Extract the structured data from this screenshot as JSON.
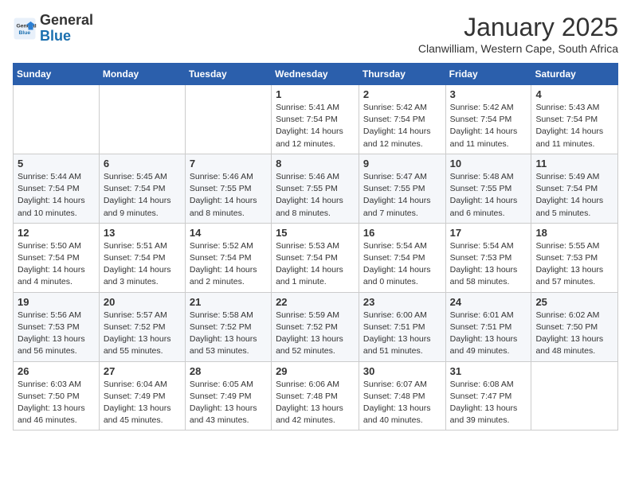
{
  "logo": {
    "line1": "General",
    "line2": "Blue"
  },
  "title": "January 2025",
  "subtitle": "Clanwilliam, Western Cape, South Africa",
  "weekdays": [
    "Sunday",
    "Monday",
    "Tuesday",
    "Wednesday",
    "Thursday",
    "Friday",
    "Saturday"
  ],
  "weeks": [
    [
      {
        "day": "",
        "info": ""
      },
      {
        "day": "",
        "info": ""
      },
      {
        "day": "",
        "info": ""
      },
      {
        "day": "1",
        "info": "Sunrise: 5:41 AM\nSunset: 7:54 PM\nDaylight: 14 hours\nand 12 minutes."
      },
      {
        "day": "2",
        "info": "Sunrise: 5:42 AM\nSunset: 7:54 PM\nDaylight: 14 hours\nand 12 minutes."
      },
      {
        "day": "3",
        "info": "Sunrise: 5:42 AM\nSunset: 7:54 PM\nDaylight: 14 hours\nand 11 minutes."
      },
      {
        "day": "4",
        "info": "Sunrise: 5:43 AM\nSunset: 7:54 PM\nDaylight: 14 hours\nand 11 minutes."
      }
    ],
    [
      {
        "day": "5",
        "info": "Sunrise: 5:44 AM\nSunset: 7:54 PM\nDaylight: 14 hours\nand 10 minutes."
      },
      {
        "day": "6",
        "info": "Sunrise: 5:45 AM\nSunset: 7:54 PM\nDaylight: 14 hours\nand 9 minutes."
      },
      {
        "day": "7",
        "info": "Sunrise: 5:46 AM\nSunset: 7:55 PM\nDaylight: 14 hours\nand 8 minutes."
      },
      {
        "day": "8",
        "info": "Sunrise: 5:46 AM\nSunset: 7:55 PM\nDaylight: 14 hours\nand 8 minutes."
      },
      {
        "day": "9",
        "info": "Sunrise: 5:47 AM\nSunset: 7:55 PM\nDaylight: 14 hours\nand 7 minutes."
      },
      {
        "day": "10",
        "info": "Sunrise: 5:48 AM\nSunset: 7:55 PM\nDaylight: 14 hours\nand 6 minutes."
      },
      {
        "day": "11",
        "info": "Sunrise: 5:49 AM\nSunset: 7:54 PM\nDaylight: 14 hours\nand 5 minutes."
      }
    ],
    [
      {
        "day": "12",
        "info": "Sunrise: 5:50 AM\nSunset: 7:54 PM\nDaylight: 14 hours\nand 4 minutes."
      },
      {
        "day": "13",
        "info": "Sunrise: 5:51 AM\nSunset: 7:54 PM\nDaylight: 14 hours\nand 3 minutes."
      },
      {
        "day": "14",
        "info": "Sunrise: 5:52 AM\nSunset: 7:54 PM\nDaylight: 14 hours\nand 2 minutes."
      },
      {
        "day": "15",
        "info": "Sunrise: 5:53 AM\nSunset: 7:54 PM\nDaylight: 14 hours\nand 1 minute."
      },
      {
        "day": "16",
        "info": "Sunrise: 5:54 AM\nSunset: 7:54 PM\nDaylight: 14 hours\nand 0 minutes."
      },
      {
        "day": "17",
        "info": "Sunrise: 5:54 AM\nSunset: 7:53 PM\nDaylight: 13 hours\nand 58 minutes."
      },
      {
        "day": "18",
        "info": "Sunrise: 5:55 AM\nSunset: 7:53 PM\nDaylight: 13 hours\nand 57 minutes."
      }
    ],
    [
      {
        "day": "19",
        "info": "Sunrise: 5:56 AM\nSunset: 7:53 PM\nDaylight: 13 hours\nand 56 minutes."
      },
      {
        "day": "20",
        "info": "Sunrise: 5:57 AM\nSunset: 7:52 PM\nDaylight: 13 hours\nand 55 minutes."
      },
      {
        "day": "21",
        "info": "Sunrise: 5:58 AM\nSunset: 7:52 PM\nDaylight: 13 hours\nand 53 minutes."
      },
      {
        "day": "22",
        "info": "Sunrise: 5:59 AM\nSunset: 7:52 PM\nDaylight: 13 hours\nand 52 minutes."
      },
      {
        "day": "23",
        "info": "Sunrise: 6:00 AM\nSunset: 7:51 PM\nDaylight: 13 hours\nand 51 minutes."
      },
      {
        "day": "24",
        "info": "Sunrise: 6:01 AM\nSunset: 7:51 PM\nDaylight: 13 hours\nand 49 minutes."
      },
      {
        "day": "25",
        "info": "Sunrise: 6:02 AM\nSunset: 7:50 PM\nDaylight: 13 hours\nand 48 minutes."
      }
    ],
    [
      {
        "day": "26",
        "info": "Sunrise: 6:03 AM\nSunset: 7:50 PM\nDaylight: 13 hours\nand 46 minutes."
      },
      {
        "day": "27",
        "info": "Sunrise: 6:04 AM\nSunset: 7:49 PM\nDaylight: 13 hours\nand 45 minutes."
      },
      {
        "day": "28",
        "info": "Sunrise: 6:05 AM\nSunset: 7:49 PM\nDaylight: 13 hours\nand 43 minutes."
      },
      {
        "day": "29",
        "info": "Sunrise: 6:06 AM\nSunset: 7:48 PM\nDaylight: 13 hours\nand 42 minutes."
      },
      {
        "day": "30",
        "info": "Sunrise: 6:07 AM\nSunset: 7:48 PM\nDaylight: 13 hours\nand 40 minutes."
      },
      {
        "day": "31",
        "info": "Sunrise: 6:08 AM\nSunset: 7:47 PM\nDaylight: 13 hours\nand 39 minutes."
      },
      {
        "day": "",
        "info": ""
      }
    ]
  ]
}
